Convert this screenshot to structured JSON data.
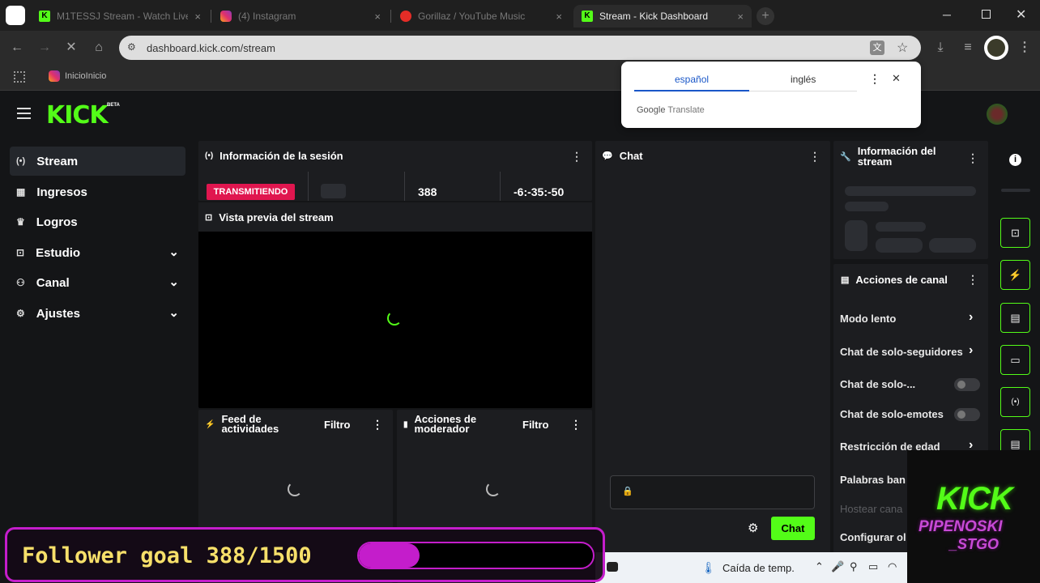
{
  "browser": {
    "tabs": [
      {
        "title": "M1TESSJ Stream - Watch Live",
        "icon": "kick-favicon",
        "active": false
      },
      {
        "title": "(4) Instagram",
        "icon": "instagram-favicon",
        "active": false
      },
      {
        "title": "Gorillaz / YouTube Music",
        "icon": "youtube-music-favicon",
        "active": false
      },
      {
        "title": "Stream - Kick Dashboard",
        "icon": "kick-favicon",
        "active": true
      }
    ],
    "url": "dashboard.kick.com/stream",
    "bookmark_label": "InicioInicio"
  },
  "translate_popup": {
    "lang_from": "español",
    "lang_to": "inglés",
    "brand_google": "Google",
    "brand_translate": "Translate"
  },
  "app": {
    "logo": "KICK",
    "logo_badge": "BETA",
    "accent": "#53fc18"
  },
  "sidebar": {
    "items": [
      {
        "label": "Stream",
        "icon": "broadcast-icon",
        "active": true
      },
      {
        "label": "Ingresos",
        "icon": "chart-icon"
      },
      {
        "label": "Logros",
        "icon": "trophy-icon"
      },
      {
        "label": "Estudio",
        "icon": "studio-icon",
        "expandable": true
      },
      {
        "label": "Canal",
        "icon": "users-icon",
        "expandable": true
      },
      {
        "label": "Ajustes",
        "icon": "gear-icon",
        "expandable": true
      }
    ]
  },
  "session": {
    "title": "Información de la sesión",
    "status": "TRANSMITIENDO",
    "viewers": "388",
    "time": "-6:-35:-50"
  },
  "preview": {
    "title": "Vista previa del stream"
  },
  "feed": {
    "title": "Feed de actividades",
    "filter": "Filtro"
  },
  "modactions": {
    "title": "Acciones de moderador",
    "filter": "Filtro"
  },
  "chat": {
    "title": "Chat",
    "send_label": "Chat"
  },
  "stream_info": {
    "title": "Información del stream"
  },
  "channel_actions": {
    "title": "Acciones de canal",
    "items": [
      {
        "label": "Modo lento",
        "type": "arrow"
      },
      {
        "label": "Chat de solo-seguidores",
        "type": "arrow"
      },
      {
        "label": "Chat de solo-...",
        "type": "toggle"
      },
      {
        "label": "Chat de solo-emotes",
        "type": "toggle"
      },
      {
        "label": "Restricción de edad",
        "type": "arrow"
      },
      {
        "label": "Palabras ban",
        "type": "none"
      },
      {
        "label": "Hostear cana",
        "type": "disabled"
      },
      {
        "label": "Configurar ol",
        "type": "none"
      }
    ]
  },
  "overlay": {
    "follower_goal_label": "Follower goal 388/1500",
    "goal_progress": 0.26,
    "goal_color": "#c41dcb",
    "branding_line1": "KICK",
    "branding_line2": "PIPENOSKI",
    "branding_line3": "_STGO"
  },
  "taskbar": {
    "weather": "Caída de temp."
  }
}
